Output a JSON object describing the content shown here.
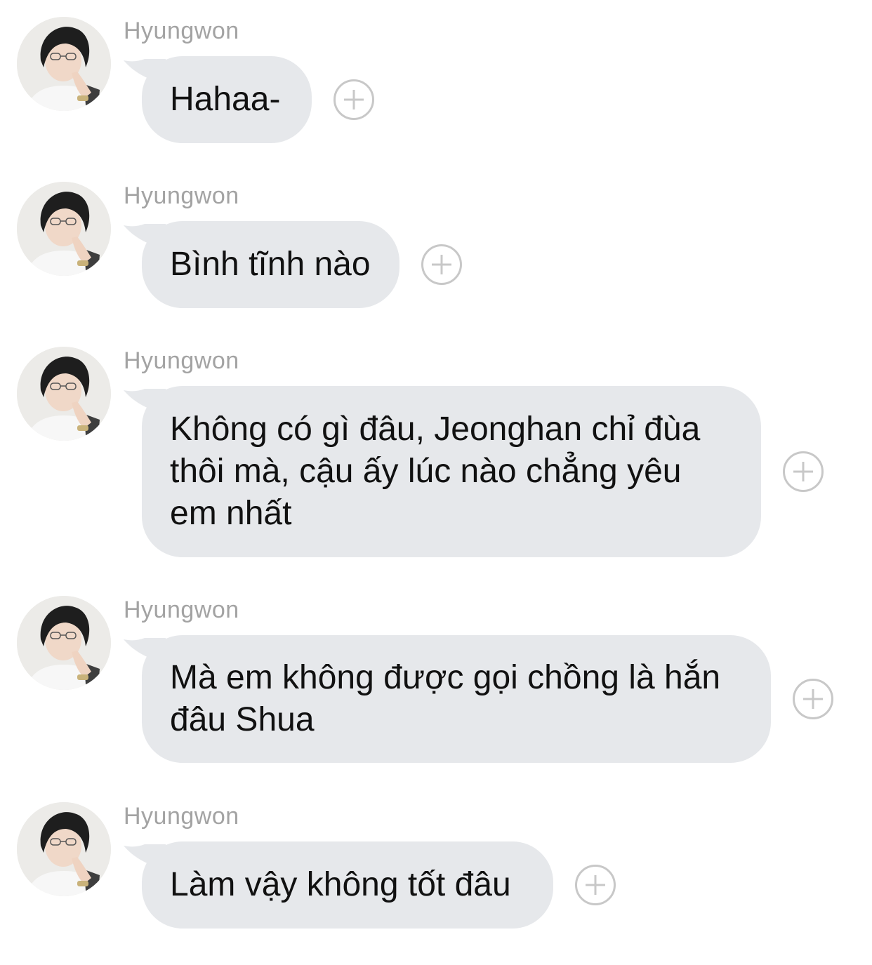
{
  "conversation": {
    "messages": [
      {
        "sender": "Hyungwon",
        "text": "Hahaa-"
      },
      {
        "sender": "Hyungwon",
        "text": "Bình tĩnh nào"
      },
      {
        "sender": "Hyungwon",
        "text": "Không có gì đâu, Jeonghan chỉ đùa\nthôi mà, cậu ấy lúc nào chẳng yêu\nem nhất"
      },
      {
        "sender": "Hyungwon",
        "text": "Mà em không được gọi chồng là hắn\nđâu Shua"
      },
      {
        "sender": "Hyungwon",
        "text": "Làm vậy không tốt đâu"
      }
    ],
    "icons": {
      "avatar": "profile-photo",
      "reaction": "add-reaction-icon"
    },
    "colors": {
      "bubble": "#e6e8eb",
      "sender_name": "#a3a3a3",
      "reaction_icon": "#c8c8c8"
    }
  }
}
